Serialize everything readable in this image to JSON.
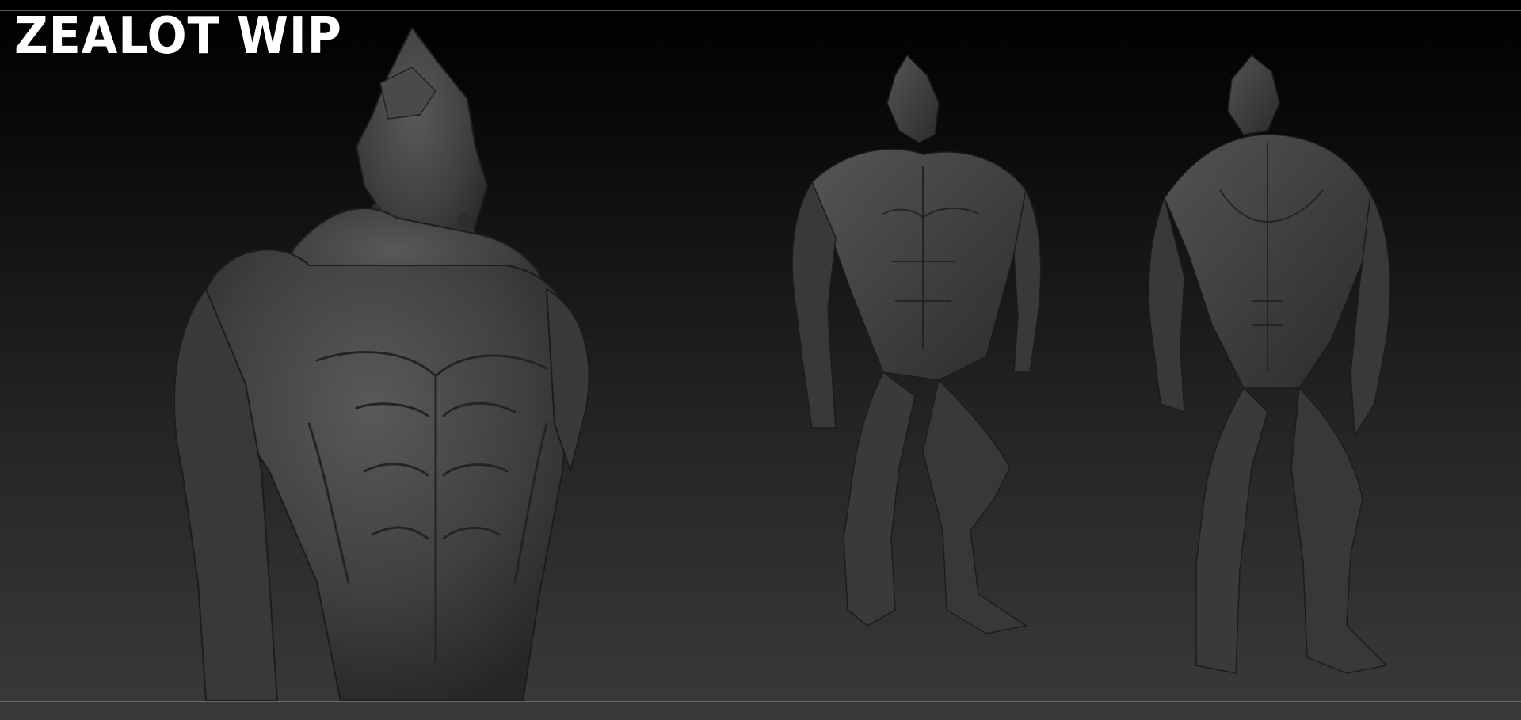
{
  "title": "ZEALOT WIP",
  "colors": {
    "background_top": "#000000",
    "background_bottom": "#3a3a3a",
    "sculpt_clay": "#3e3e3e",
    "title_text": "#ffffff"
  }
}
